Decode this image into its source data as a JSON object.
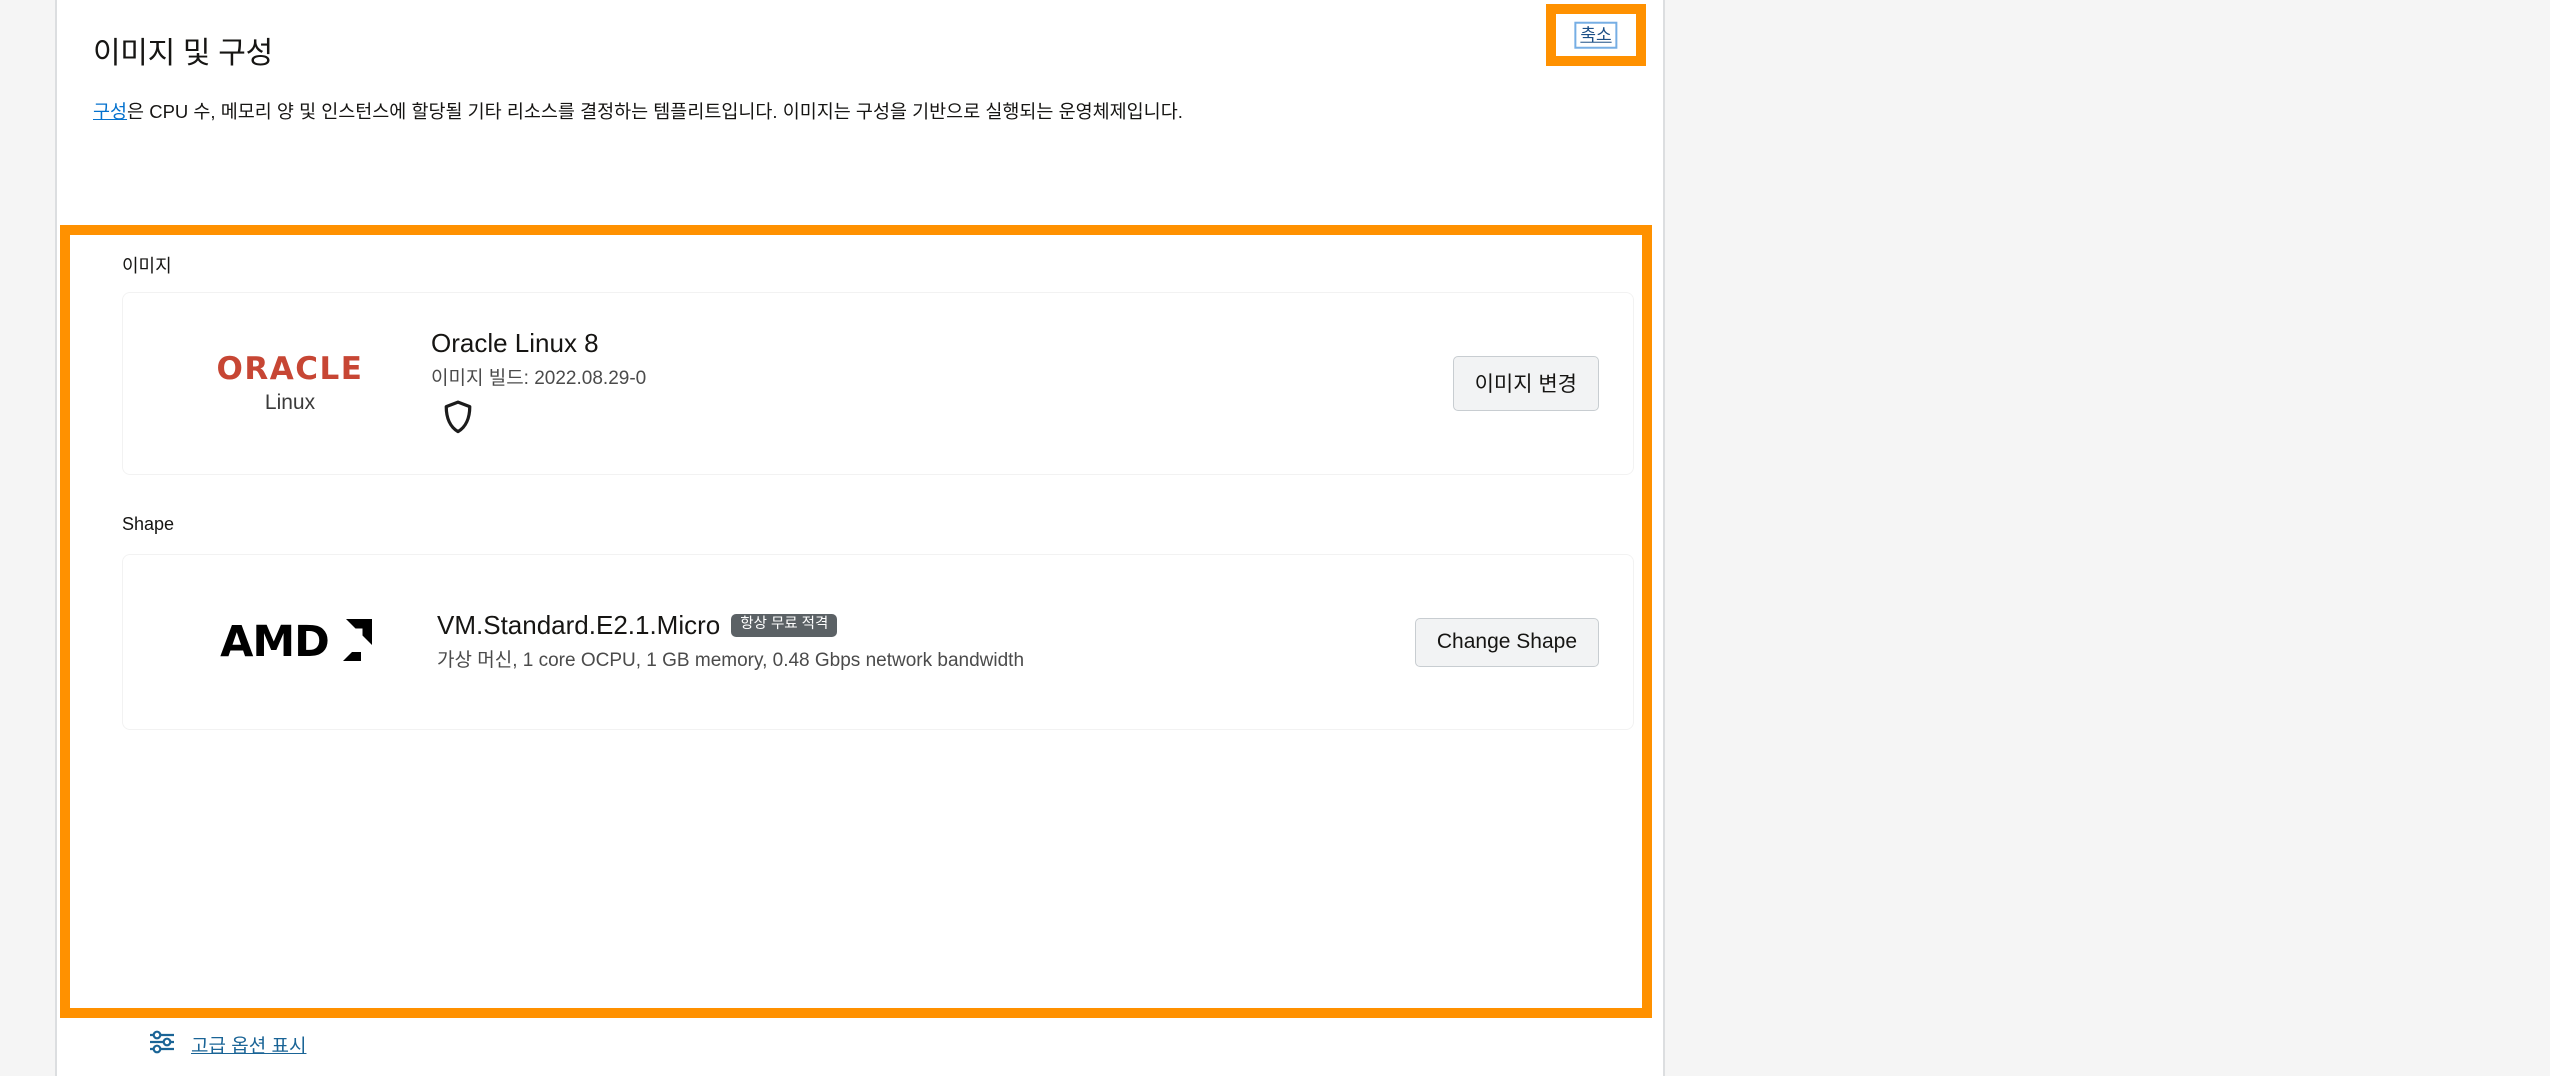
{
  "section": {
    "title": "이미지 및 구성",
    "description_link": "구성",
    "description_rest": "은 CPU 수, 메모리 양 및 인스턴스에 할당될 기타 리소스를 결정하는 템플리트입니다. 이미지는 구성을 기반으로 실행되는 운영체제입니다.",
    "collapse_label": "축소"
  },
  "image": {
    "label": "이미지",
    "logo_primary": "ORACLE",
    "logo_secondary": "Linux",
    "name": "Oracle Linux 8",
    "build": "이미지 빌드: 2022.08.29-0",
    "change_button": "이미지 변경"
  },
  "shape": {
    "label": "Shape",
    "logo": "AMD",
    "name": "VM.Standard.E2.1.Micro",
    "badge": "항상 무료 적격",
    "details": "가상 머신, 1 core OCPU, 1 GB memory, 0.48 Gbps network bandwidth",
    "change_button": "Change Shape"
  },
  "footer": {
    "advanced_options": "고급 옵션 표시"
  },
  "colors": {
    "highlight": "#ff9100",
    "link": "#0572ce",
    "oracle_red": "#c74634",
    "badge_bg": "#5b6165",
    "focus_ring": "#76aee4"
  }
}
